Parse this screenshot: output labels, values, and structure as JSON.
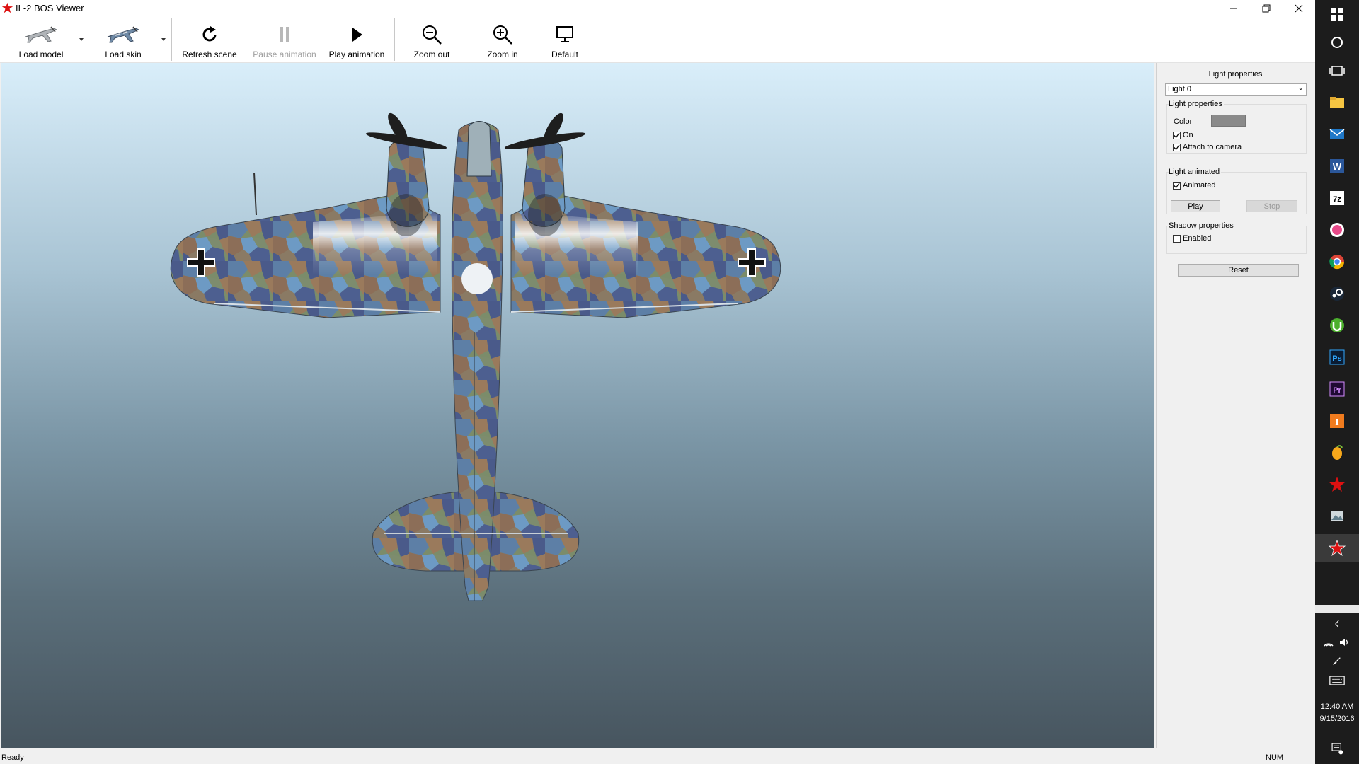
{
  "window": {
    "title": "IL-2 BOS Viewer"
  },
  "toolbar": {
    "items": [
      {
        "label": "Load model",
        "icon": "plane-model-icon",
        "enabled": true,
        "dropdown": true
      },
      {
        "label": "Load skin",
        "icon": "plane-skin-icon",
        "enabled": true,
        "dropdown": true
      },
      {
        "label": "Refresh scene",
        "icon": "refresh-icon",
        "enabled": true
      },
      {
        "label": "Pause animation",
        "icon": "pause-icon",
        "enabled": false
      },
      {
        "label": "Play animation",
        "icon": "play-icon",
        "enabled": true
      },
      {
        "label": "Zoom out",
        "icon": "zoom-out-icon",
        "enabled": true
      },
      {
        "label": "Zoom in",
        "icon": "zoom-in-icon",
        "enabled": true
      },
      {
        "label": "Default",
        "icon": "monitor-icon",
        "enabled": true
      }
    ]
  },
  "panel": {
    "title": "Light properties",
    "light_select": {
      "value": "Light 0"
    },
    "light_group": {
      "title": "Light properties",
      "color_label": "Color",
      "color_value": "#8a8a8a",
      "on": {
        "label": "On",
        "checked": true
      },
      "attach": {
        "label": "Attach to camera",
        "checked": true
      }
    },
    "animated_group": {
      "title": "Light animated",
      "animated": {
        "label": "Animated",
        "checked": true
      },
      "play_label": "Play",
      "stop_label": "Stop"
    },
    "shadow_group": {
      "title": "Shadow properties",
      "enabled": {
        "label": "Enabled",
        "checked": false
      }
    },
    "reset_label": "Reset"
  },
  "statusbar": {
    "status": "Ready",
    "num": "NUM"
  },
  "taskbar": {
    "icons": [
      "windows-start-icon",
      "search-circle-icon",
      "task-view-icon",
      "file-explorer-icon",
      "mail-icon",
      "word-icon",
      "7zip-icon",
      "itunes-icon",
      "chrome-icon",
      "steam-icon",
      "utorrent-icon",
      "photoshop-icon",
      "premiere-icon",
      "app-i-icon",
      "fl-studio-icon",
      "red-star-icon",
      "photos-icon",
      "il2-viewer-icon"
    ],
    "time": "12:40 AM",
    "date": "9/15/2016"
  },
  "colors": {
    "viewport_top": "#d9eefa",
    "viewport_bottom": "#47555f",
    "taskbar": "#1c1c1c"
  }
}
